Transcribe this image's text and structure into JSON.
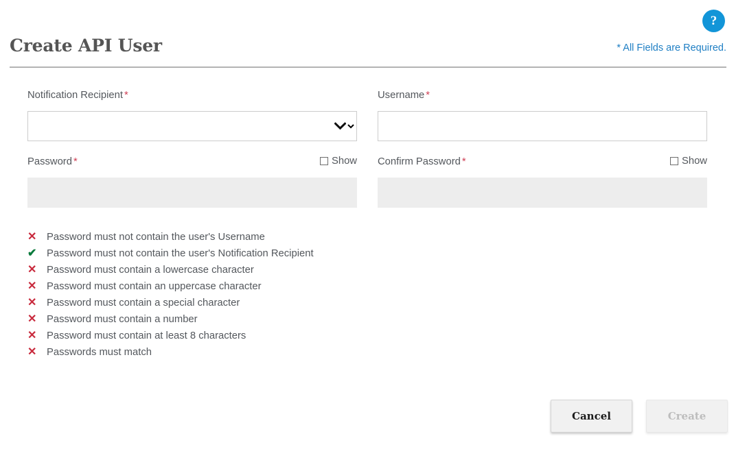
{
  "header": {
    "title": "Create API User",
    "required_note": "* All Fields are Required.",
    "help_icon_label": "?",
    "accent_blue": "#1295d8",
    "link_blue": "#1f7fc4",
    "rule_color": "#b3b3b3"
  },
  "form": {
    "required_marker": "*",
    "fields": {
      "notification_recipient": {
        "label": "Notification Recipient",
        "value": "",
        "placeholder": "",
        "chevron_icon": "chevron-down-icon"
      },
      "username": {
        "label": "Username",
        "value": "",
        "placeholder": ""
      },
      "password": {
        "label": "Password",
        "value": "",
        "placeholder": "",
        "show_label": "Show",
        "show_checked": false
      },
      "confirm_password": {
        "label": "Confirm Password",
        "value": "",
        "placeholder": "",
        "show_label": "Show",
        "show_checked": false
      }
    }
  },
  "validation": {
    "fail_icon": "✕",
    "pass_icon": "✔",
    "fail_color": "#c8293c",
    "pass_color": "#0a7a3c",
    "rules": [
      {
        "text": "Password must not contain the user's Username",
        "status": "fail"
      },
      {
        "text": "Password must not contain the user's Notification Recipient",
        "status": "pass"
      },
      {
        "text": "Password must contain a lowercase character",
        "status": "fail"
      },
      {
        "text": "Password must contain an uppercase character",
        "status": "fail"
      },
      {
        "text": "Password must contain a special character",
        "status": "fail"
      },
      {
        "text": "Password must contain a number",
        "status": "fail"
      },
      {
        "text": "Password must contain at least 8 characters",
        "status": "fail"
      },
      {
        "text": "Passwords must match",
        "status": "fail"
      }
    ]
  },
  "footer": {
    "cancel_label": "Cancel",
    "create_label": "Create",
    "create_disabled": true
  }
}
